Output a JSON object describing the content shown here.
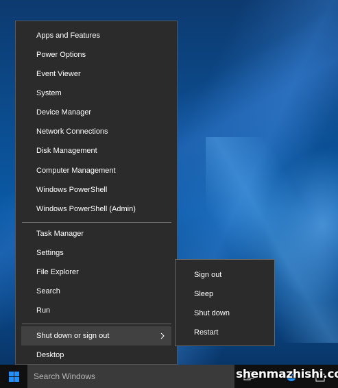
{
  "winx_menu": {
    "items": [
      {
        "label": "Apps and Features"
      },
      {
        "label": "Power Options"
      },
      {
        "label": "Event Viewer"
      },
      {
        "label": "System"
      },
      {
        "label": "Device Manager"
      },
      {
        "label": "Network Connections"
      },
      {
        "label": "Disk Management"
      },
      {
        "label": "Computer Management"
      },
      {
        "label": "Windows PowerShell"
      },
      {
        "label": "Windows PowerShell (Admin)"
      },
      {
        "label": "Task Manager"
      },
      {
        "label": "Settings"
      },
      {
        "label": "File Explorer"
      },
      {
        "label": "Search"
      },
      {
        "label": "Run"
      },
      {
        "label": "Shut down or sign out"
      },
      {
        "label": "Desktop"
      }
    ],
    "highlighted_item": "Shut down or sign out"
  },
  "submenu": {
    "items": [
      {
        "label": "Sign out"
      },
      {
        "label": "Sleep"
      },
      {
        "label": "Shut down"
      },
      {
        "label": "Restart"
      }
    ]
  },
  "taskbar": {
    "search_placeholder": "Search Windows",
    "start_icon": "windows-logo-icon"
  },
  "watermark": {
    "text": "shenmazhishi.com"
  },
  "colors": {
    "menu_bg": "#2b2b2b",
    "menu_highlight": "#414141",
    "taskbar_bg": "#101010",
    "search_bg": "#3a3a3a",
    "windows_blue": "#0a5aa6"
  }
}
